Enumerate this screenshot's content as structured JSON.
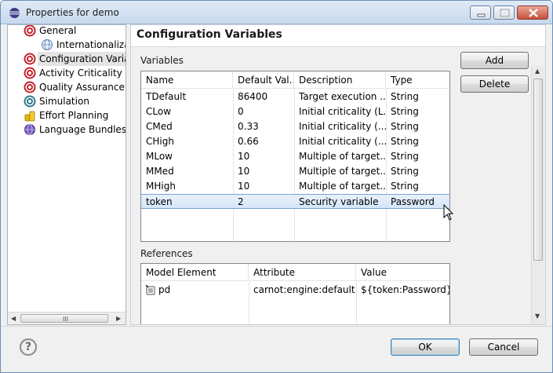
{
  "window": {
    "title": "Properties for demo"
  },
  "tree": {
    "items": [
      {
        "label": "General",
        "icon": "spiral-icon",
        "level": 0
      },
      {
        "label": "Internationalizat",
        "icon": "globe-icon",
        "level": 1
      },
      {
        "label": "Configuration Varia",
        "icon": "spiral-icon",
        "level": 0,
        "selected": true
      },
      {
        "label": "Activity Criticality",
        "icon": "spiral-icon",
        "level": 0
      },
      {
        "label": "Quality Assurance C",
        "icon": "spiral-icon",
        "level": 0
      },
      {
        "label": "Simulation",
        "icon": "spiral-icon",
        "level": 0
      },
      {
        "label": "Effort Planning",
        "icon": "coins-icon",
        "level": 0
      },
      {
        "label": "Language Bundles",
        "icon": "globe-icon",
        "level": 0
      }
    ],
    "scroll_grip": "III"
  },
  "main": {
    "title": "Configuration Variables",
    "variables_label": "Variables",
    "references_label": "References",
    "add_label": "Add",
    "delete_label": "Delete"
  },
  "variables_table": {
    "columns": [
      "Name",
      "Default Val...",
      "Description",
      "Type"
    ],
    "rows": [
      [
        "TDefault",
        "86400",
        "Target execution ...",
        "String"
      ],
      [
        "CLow",
        "0",
        "Initial criticality (L...",
        "String"
      ],
      [
        "CMed",
        "0.33",
        "Initial criticality (...",
        "String"
      ],
      [
        "CHigh",
        "0.66",
        "Initial criticality (...",
        "String"
      ],
      [
        "MLow",
        "10",
        "Multiple of target...",
        "String"
      ],
      [
        "MMed",
        "10",
        "Multiple of target...",
        "String"
      ],
      [
        "MHigh",
        "10",
        "Multiple of target...",
        "String"
      ],
      [
        "token",
        "2",
        "Security variable",
        "Password"
      ]
    ],
    "selected_row": 7
  },
  "references_table": {
    "columns": [
      "Model Element",
      "Attribute",
      "Value"
    ],
    "rows": [
      [
        "pd",
        "carnot:engine:default...",
        "${token:Password}"
      ]
    ]
  },
  "footer": {
    "help_label": "?",
    "ok_label": "OK",
    "cancel_label": "Cancel"
  },
  "colors": {
    "selection": "#d4e6f9",
    "spiral": "#c8232c",
    "accent": "#3c7fb1"
  }
}
